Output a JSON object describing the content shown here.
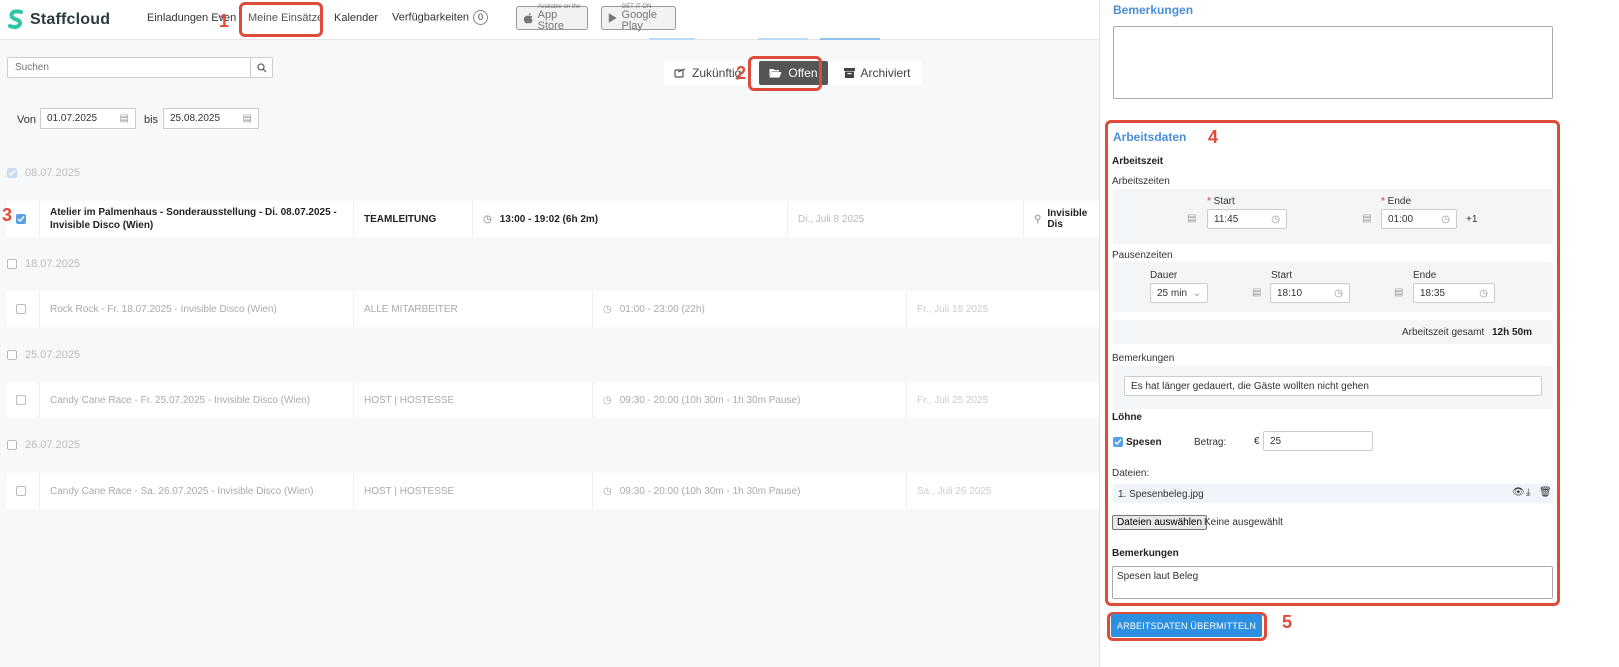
{
  "app": {
    "name": "Staffcloud"
  },
  "nav": {
    "items": [
      {
        "label": "Einladungen Even"
      },
      {
        "label": "Meine Einsätze"
      },
      {
        "label": "Kalender"
      },
      {
        "label": "Verfügbarkeiten"
      }
    ],
    "availability_count": "0",
    "appstore": {
      "small": "Available on the",
      "big": "App Store"
    },
    "googleplay": {
      "small": "GET IT ON",
      "big": "Google Play"
    }
  },
  "annotations": [
    "1",
    "2",
    "3",
    "4",
    "5"
  ],
  "search": {
    "placeholder": "Suchen"
  },
  "tabs": [
    {
      "label": "Zukünftig"
    },
    {
      "label": "Offen"
    },
    {
      "label": "Archiviert"
    }
  ],
  "filter": {
    "from_label": "Von",
    "from": "01.07.2025",
    "to_label": "bis",
    "to": "25.08.2025"
  },
  "groups": [
    {
      "date": "08.07.2025"
    },
    {
      "date": "18.07.2025"
    },
    {
      "date": "25.07.2025"
    },
    {
      "date": "26.07.2025"
    }
  ],
  "rows": [
    {
      "title": "Atelier im Palmenhaus - Sonderausstellung - Di. 08.07.2025 - Invisible Disco (Wien)",
      "role": "TEAMLEITUNG",
      "time": "13:00 - 19:02 (6h 2m)",
      "date": "Di., Juli 8 2025",
      "location": "Invisible Dis"
    },
    {
      "title": "Rock Rock - Fr. 18.07.2025 - Invisible Disco (Wien)",
      "role": "ALLE MITARBEITER",
      "time": "01:00 - 23:00 (22h)",
      "date": "Fr., Juli 18 2025"
    },
    {
      "title": "Candy Cane Race - Fr. 25.07.2025 - Invisible Disco (Wien)",
      "role": "HOST | HOSTESSE",
      "time": "09:30 - 20:00 (10h 30m - 1h 30m Pause)",
      "date": "Fr., Juli 25 2025"
    },
    {
      "title": "Candy Cane Race - Sa. 26.07.2025 - Invisible Disco (Wien)",
      "role": "HOST | HOSTESSE",
      "time": "09:30 - 20:00 (10h 30m - 1h 30m Pause)",
      "date": "Sa., Juli 26 2025"
    }
  ],
  "panel": {
    "remarks_title": "Bemerkungen",
    "workdata_title": "Arbeitsdaten",
    "worktime_label": "Arbeitszeit",
    "worktimes_label": "Arbeitszeiten",
    "start_label": "Start",
    "end_label": "Ende",
    "start_value": "11:45",
    "end_value": "01:00",
    "next_day": "+1",
    "breaks_label": "Pausenzeiten",
    "duration_label": "Dauer",
    "break_duration": "25 min",
    "break_start_label": "Start",
    "break_start": "18:10",
    "break_end_label": "Ende",
    "break_end": "18:35",
    "total_label": "Arbeitszeit gesamt",
    "total_value": "12h 50m",
    "remarks_label": "Bemerkungen",
    "remarks_value": "Es hat länger gedauert, die Gäste wollten nicht gehen",
    "wages_label": "Löhne",
    "expenses_label": "Spesen",
    "amount_label": "Betrag:",
    "currency": "€",
    "amount_value": "25",
    "files_label": "Dateien:",
    "file_name": "1. Spesenbeleg.jpg",
    "choose_files": "Dateien auswählen",
    "no_file": "Keine ausgewählt",
    "remarks2_label": "Bemerkungen",
    "remarks2_value": "Spesen laut Beleg",
    "submit": "ARBEITSDATEN ÜBERMITTELN"
  }
}
